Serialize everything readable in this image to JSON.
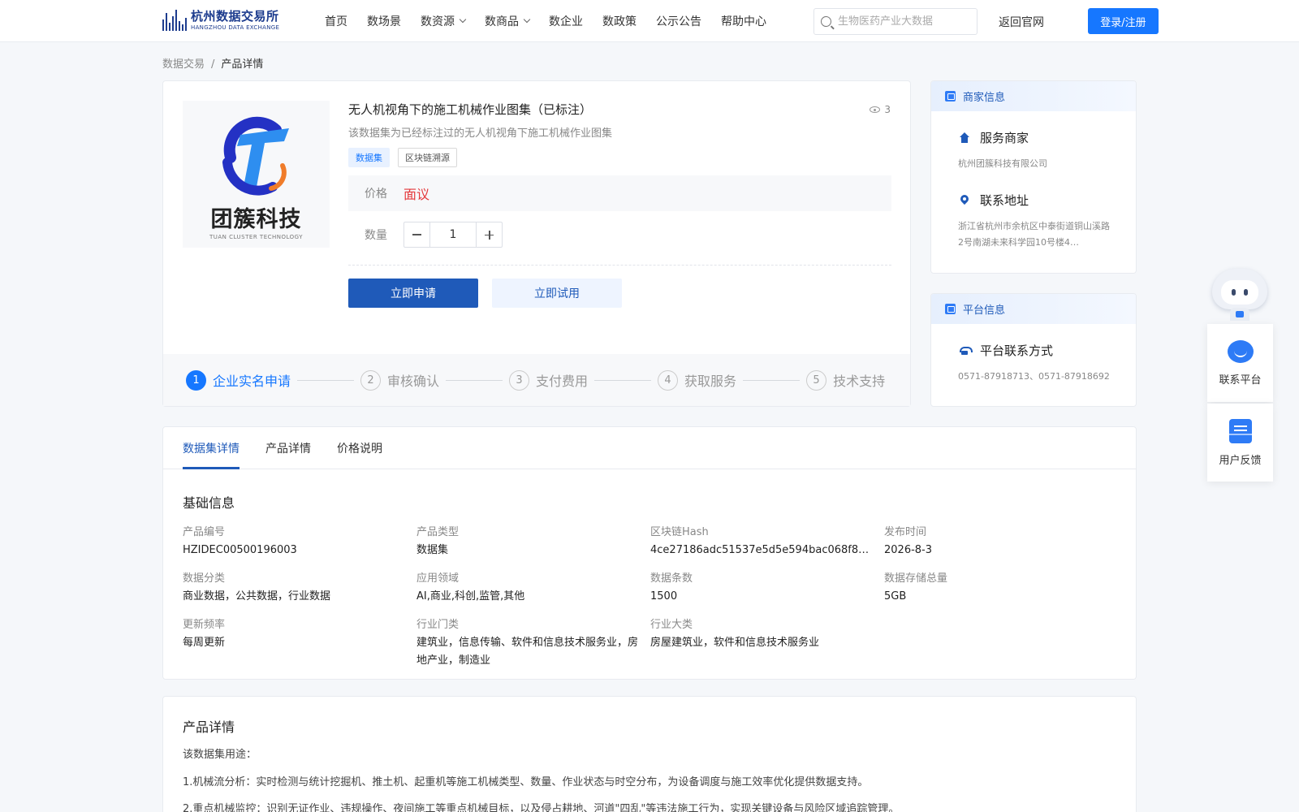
{
  "header": {
    "logo_cn": "杭州数据交易所",
    "logo_en": "HANGZHOU DATA EXCHANGE",
    "nav": [
      {
        "label": "首页"
      },
      {
        "label": "数场景"
      },
      {
        "label": "数资源",
        "dropdown": true
      },
      {
        "label": "数商品",
        "dropdown": true
      },
      {
        "label": "数企业"
      },
      {
        "label": "数政策"
      },
      {
        "label": "公示公告"
      },
      {
        "label": "帮助中心"
      }
    ],
    "search_placeholder": "生物医药产业大数据",
    "back_link": "返回官网",
    "login": "登录/注册"
  },
  "breadcrumb": {
    "root": "数据交易",
    "sep": "/",
    "current": "产品详情"
  },
  "product": {
    "brand_cn": "团簇科技",
    "brand_en": "TUAN CLUSTER TECHNOLOGY",
    "title": "无人机视角下的施工机械作业图集（已标注）",
    "views": "3",
    "description": "该数据集为已经标注过的无人机视角下施工机械作业图集",
    "tags": [
      "数据集",
      "区块链溯源"
    ],
    "price_label": "价格",
    "price_value": "面议",
    "quantity_label": "数量",
    "quantity_value": "1",
    "apply_button": "立即申请",
    "trial_button": "立即试用",
    "steps": [
      {
        "num": "1",
        "label": "企业实名申请"
      },
      {
        "num": "2",
        "label": "审核确认"
      },
      {
        "num": "3",
        "label": "支付费用"
      },
      {
        "num": "4",
        "label": "获取服务"
      },
      {
        "num": "5",
        "label": "技术支持"
      }
    ]
  },
  "merchant": {
    "header": "商家信息",
    "service_title": "服务商家",
    "service_value": "杭州团簇科技有限公司",
    "address_title": "联系地址",
    "address_value": "浙江省杭州市余杭区中泰街道铜山溪路2号南湖未来科学园10号楼4…"
  },
  "platform": {
    "header": "平台信息",
    "contact_title": "平台联系方式",
    "contact_value": "0571-87918713、0571-87918692"
  },
  "widgets": {
    "contact": "联系平台",
    "feedback": "用户反馈"
  },
  "detail": {
    "tabs": [
      "数据集详情",
      "产品详情",
      "价格说明"
    ],
    "section_title": "基础信息",
    "fields": [
      {
        "k": "产品编号",
        "v": "HZIDEC00500196003"
      },
      {
        "k": "产品类型",
        "v": "数据集"
      },
      {
        "k": "区块链Hash",
        "v": "4ce27186adc51537e5d5e594bac068f83e…"
      },
      {
        "k": "发布时间",
        "v": "2026-8-3"
      },
      {
        "k": "数据分类",
        "v": "商业数据，公共数据，行业数据"
      },
      {
        "k": "应用领域",
        "v": "AI,商业,科创,监管,其他"
      },
      {
        "k": "数据条数",
        "v": "1500"
      },
      {
        "k": "数据存储总量",
        "v": "5GB"
      },
      {
        "k": "更新频率",
        "v": "每周更新"
      },
      {
        "k": "行业门类",
        "v": "建筑业，信息传输、软件和信息技术服务业，房地产业，制造业"
      },
      {
        "k": "行业大类",
        "v": "房屋建筑业，软件和信息技术服务业"
      }
    ]
  },
  "desc": {
    "title": "产品详情",
    "intro": "该数据集用途：",
    "line1": "1.机械流分析：实时检测与统计挖掘机、推土机、起重机等施工机械类型、数量、作业状态与时空分布，为设备调度与施工效率优化提供数据支持。",
    "line2": "2.重点机械监控：识别无证作业、违规操作、夜间施工等重点机械目标，以及侵占耕地、河道\"四乱\"等违法施工行为，实现关键设备与风险区域追踪管理。"
  },
  "colors": {
    "primary": "#1f5ab9",
    "accent": "#1677ff",
    "price": "#e4393c"
  }
}
